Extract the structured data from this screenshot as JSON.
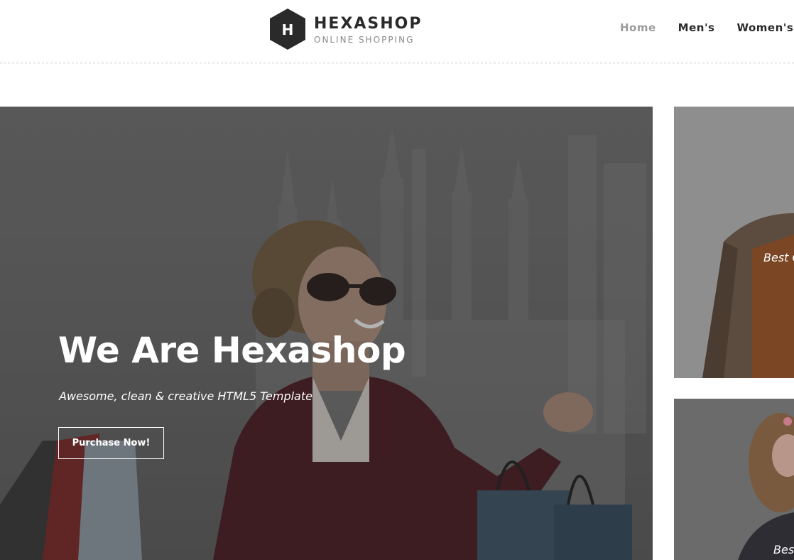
{
  "brand": {
    "logo_letter": "H",
    "name": "HEXASHOP",
    "tagline": "ONLINE SHOPPING"
  },
  "nav": {
    "items": [
      {
        "label": "Home",
        "active": true
      },
      {
        "label": "Men's",
        "active": false
      },
      {
        "label": "Women's",
        "active": false
      }
    ]
  },
  "hero": {
    "title": "We Are Hexashop",
    "subtitle": "Awesome, clean & creative HTML5 Template",
    "button_label": "Purchase Now!"
  },
  "side_cards": [
    {
      "caption": "Best C"
    },
    {
      "caption": "Bes"
    }
  ],
  "colors": {
    "text_dark": "#2a2a2a",
    "nav_active": "#9c9c9c",
    "white": "#ffffff"
  }
}
